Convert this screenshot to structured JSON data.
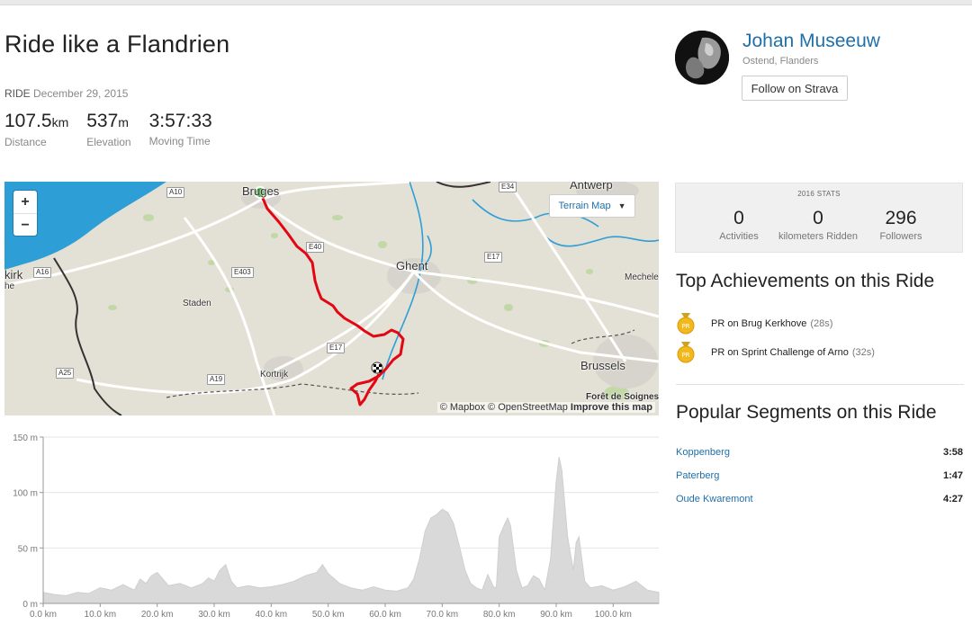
{
  "activity": {
    "title": "Ride like a Flandrien",
    "type": "RIDE",
    "date": "December 29, 2015",
    "stats": [
      {
        "value": "107.5",
        "unit": "km",
        "label": "Distance"
      },
      {
        "value": "537",
        "unit": "m",
        "label": "Elevation"
      },
      {
        "value": "3:57:33",
        "unit": "",
        "label": "Moving Time"
      }
    ]
  },
  "athlete": {
    "name": "Johan Museeuw",
    "location": "Ostend, Flanders",
    "follow_label": "Follow on Strava"
  },
  "map": {
    "zoom_in": "+",
    "zoom_out": "−",
    "layer_button": "Terrain Map",
    "attribution": "© Mapbox © OpenStreetMap",
    "improve": "Improve this map",
    "labels": {
      "bruges": "Bruges",
      "antwerp": "Antwerp",
      "ghent": "Ghent",
      "staden": "Staden",
      "kortrijk": "Kortrijk",
      "brussels": "Brussels",
      "mechelen": "Mechele",
      "kirk": "kirk",
      "he": "he",
      "foret": "Forêt de Soignes"
    },
    "roads": [
      "A10",
      "E34",
      "E40",
      "E17",
      "E403",
      "A16",
      "E17",
      "A19",
      "A25"
    ],
    "colors": {
      "water": "#2e9ed6",
      "land": "#e3e0d5",
      "route": "#e30613",
      "start": "#1ea01e"
    }
  },
  "chart_data": {
    "type": "area",
    "title": "",
    "xlabel": "",
    "ylabel": "",
    "xlim": [
      0,
      108
    ],
    "ylim": [
      0,
      150
    ],
    "x_ticks": [
      "0.0 km",
      "10.0 km",
      "20.0 km",
      "30.0 km",
      "40.0 km",
      "50.0 km",
      "60.0 km",
      "70.0 km",
      "80.0 km",
      "90.0 km",
      "100.0 km"
    ],
    "y_ticks": [
      "150 m",
      "100 m",
      "50 m",
      "0 m"
    ],
    "series": [
      {
        "x": [
          0,
          2,
          4,
          6,
          8,
          10,
          12,
          14,
          16,
          17,
          18,
          19,
          20,
          21,
          22,
          24,
          26,
          28,
          29,
          30,
          31,
          32,
          33,
          34,
          36,
          38,
          40,
          42,
          44,
          46,
          48,
          49,
          50,
          52,
          54,
          56,
          58,
          60,
          62,
          64,
          65,
          66,
          67,
          68,
          69,
          70,
          71,
          72,
          73,
          74,
          75,
          76,
          77,
          78,
          79,
          79.5,
          80,
          81,
          81.5,
          82,
          83,
          84,
          85,
          86,
          87,
          88,
          89,
          90,
          90.5,
          91,
          92,
          93,
          93.5,
          94,
          95,
          96,
          98,
          100,
          102,
          104,
          106,
          108
        ],
        "y": [
          10,
          8,
          7,
          10,
          9,
          14,
          12,
          17,
          12,
          22,
          18,
          25,
          28,
          22,
          16,
          18,
          14,
          18,
          23,
          20,
          30,
          35,
          20,
          14,
          16,
          14,
          15,
          17,
          20,
          25,
          28,
          35,
          27,
          18,
          14,
          12,
          15,
          12,
          11,
          14,
          22,
          40,
          65,
          77,
          80,
          85,
          82,
          72,
          52,
          30,
          18,
          14,
          12,
          26,
          15,
          14,
          60,
          72,
          77,
          70,
          30,
          14,
          16,
          25,
          22,
          12,
          40,
          110,
          132,
          120,
          60,
          30,
          55,
          60,
          20,
          14,
          16,
          12,
          15,
          20,
          12,
          10
        ]
      }
    ]
  },
  "side": {
    "stats_header": "2016 STATS",
    "stats": [
      {
        "value": "0",
        "label": "Activities"
      },
      {
        "value": "0",
        "label": "kilometers Ridden"
      },
      {
        "value": "296",
        "label": "Followers"
      }
    ],
    "achievements_title": "Top Achievements on this Ride",
    "achievements": [
      {
        "medal": "PR",
        "text": "PR on Brug Kerkhove",
        "time": "(28s)"
      },
      {
        "medal": "PR",
        "text": "PR on Sprint Challenge of Arno",
        "time": "(32s)"
      }
    ],
    "segments_title": "Popular Segments on this Ride",
    "segments": [
      {
        "name": "Koppenberg",
        "time": "3:58"
      },
      {
        "name": "Paterberg",
        "time": "1:47"
      },
      {
        "name": "Oude Kwaremont",
        "time": "4:27"
      }
    ]
  }
}
